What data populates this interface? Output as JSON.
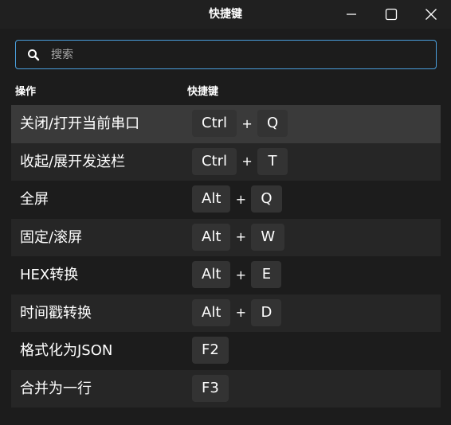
{
  "window": {
    "title": "快捷键"
  },
  "search": {
    "placeholder": "搜索",
    "value": ""
  },
  "table": {
    "header_action": "操作",
    "header_shortcut": "快捷键",
    "rows": [
      {
        "action": "关闭/打开当前串口",
        "keys": [
          "Ctrl",
          "Q"
        ],
        "selected": true
      },
      {
        "action": "收起/展开发送栏",
        "keys": [
          "Ctrl",
          "T"
        ]
      },
      {
        "action": "全屏",
        "keys": [
          "Alt",
          "Q"
        ]
      },
      {
        "action": "固定/滚屏",
        "keys": [
          "Alt",
          "W"
        ]
      },
      {
        "action": "HEX转换",
        "keys": [
          "Alt",
          "E"
        ]
      },
      {
        "action": "时间戳转换",
        "keys": [
          "Alt",
          "D"
        ]
      },
      {
        "action": "格式化为JSON",
        "keys": [
          "F2"
        ]
      },
      {
        "action": "合并为一行",
        "keys": [
          "F3"
        ]
      }
    ],
    "plus_sign": "+"
  },
  "icons": {
    "minimize": "minimize-icon",
    "maximize": "maximize-icon",
    "close": "close-icon",
    "search": "search-icon"
  },
  "colors": {
    "background": "#1c1c1c",
    "row_alt": "#262626",
    "row_selected": "#3a3a3a",
    "key_bg": "#333333",
    "accent": "#4a9fdc"
  }
}
